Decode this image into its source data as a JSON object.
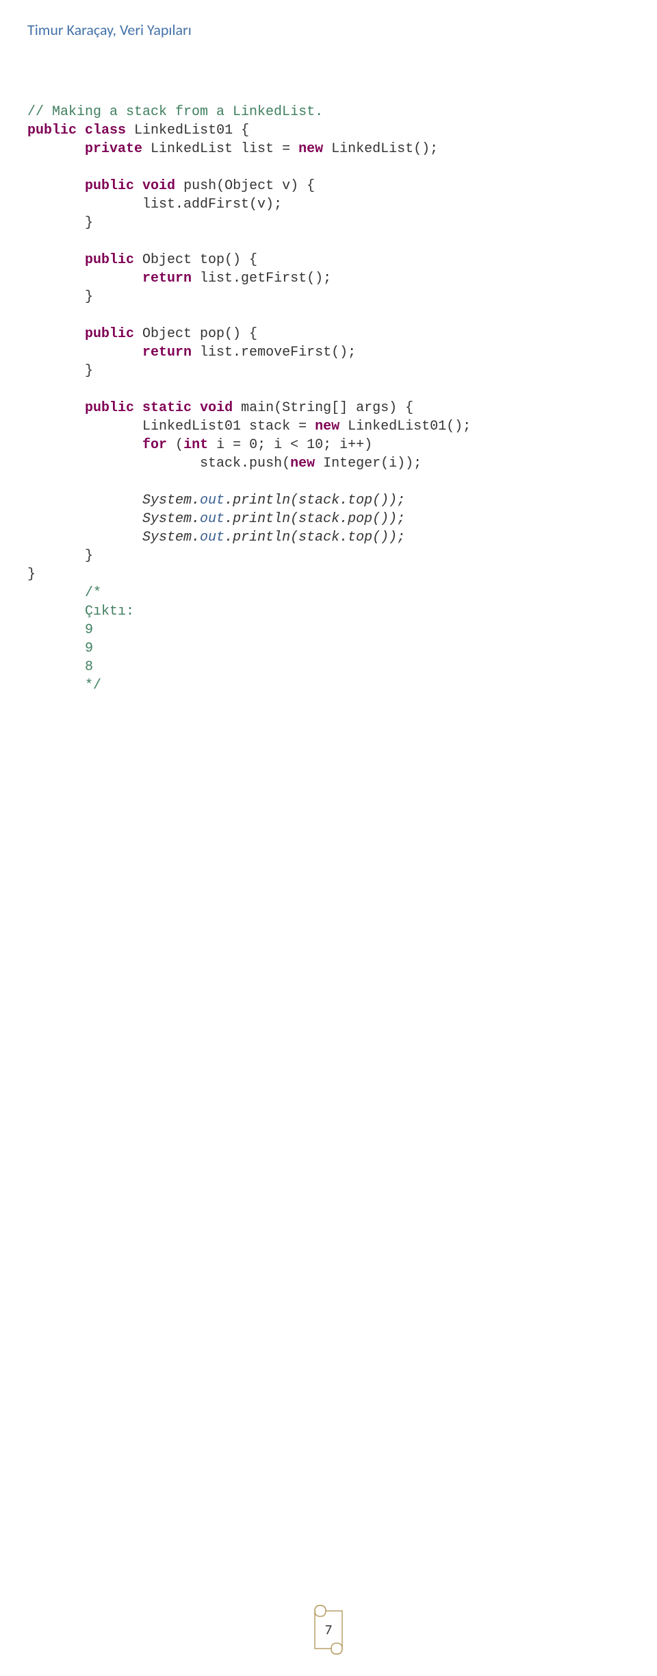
{
  "header": "Timur Karaçay, Veri Yapıları",
  "code": {
    "c1": "// Making a stack from a LinkedList.",
    "l1_a": "public",
    "l1_b": " ",
    "l1_c": "class",
    "l1_d": " LinkedList01 {",
    "l2_a": "private",
    "l2_b": " LinkedList list = ",
    "l2_c": "new",
    "l2_d": " LinkedList();",
    "l3_a": "public",
    "l3_b": " ",
    "l3_c": "void",
    "l3_d": " push(Object v) {",
    "l4": "list.addFirst(v);",
    "l5": "}",
    "l6_a": "public",
    "l6_b": " Object top() {",
    "l7_a": "return",
    "l7_b": " list.getFirst();",
    "l8": "}",
    "l9_a": "public",
    "l9_b": " Object pop() {",
    "l10_a": "return",
    "l10_b": " list.removeFirst();",
    "l11": "}",
    "l12_a": "public",
    "l12_b": " ",
    "l12_c": "static",
    "l12_d": " ",
    "l12_e": "void",
    "l12_f": " main(String[] args) {",
    "l13_a": "LinkedList01 stack = ",
    "l13_b": "new",
    "l13_c": " LinkedList01();",
    "l14_a": "for",
    "l14_b": " (",
    "l14_c": "int",
    "l14_d": " i = 0; i < 10; i++)",
    "l15_a": "stack.push(",
    "l15_b": "new",
    "l15_c": " Integer(i));",
    "l16_a": "System.",
    "l16_b": "out",
    "l16_c": ".println(stack.top());",
    "l17_a": "System.",
    "l17_b": "out",
    "l17_c": ".println(stack.pop());",
    "l18_a": "System.",
    "l18_b": "out",
    "l18_c": ".println(stack.top());",
    "l19": "}",
    "l20": "}",
    "out1": "/*",
    "out2": "Çıktı:",
    "out3": "9",
    "out4": "9",
    "out5": "8",
    "out6": "*/"
  },
  "page_number": "7"
}
